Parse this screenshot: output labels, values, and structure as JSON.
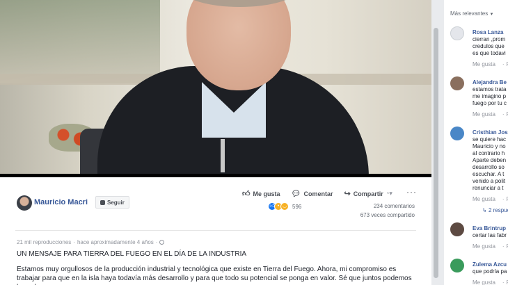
{
  "post": {
    "author": "Mauricio Macri",
    "follow_label": "Seguir",
    "actions": {
      "like": "Me gusta",
      "comment": "Comentar",
      "share": "Compartir"
    },
    "reaction_count": "596",
    "comment_count": "234 comentarios",
    "share_count": "673 veces compartido",
    "views": "21 mil reproducciones",
    "dot": "·",
    "time": "hace aproximadamente 4 años",
    "headline": "UN MENSAJE PARA TIERRA DEL FUEGO EN EL DÍA DE LA INDUSTRIA",
    "body": "Estamos muy orgullosos de la producción industrial y tecnológica que existe en Tierra del Fuego. Ahora, mi compromiso es trabajar para que en la isla haya todavía más desarrollo y para que todo su potencial se ponga en valor. Sé que juntos podemos lograrlo."
  },
  "comments_panel": {
    "sort_label": "Más relevantes",
    "like_label": "Me gusta",
    "reply_label": "Res",
    "items": [
      {
        "name": "Rosa Lanza",
        "lines": [
          "cierran ,prom",
          "credulos que",
          "es que todavi"
        ],
        "avatar_color": "#e4e6eb"
      },
      {
        "name": "Alejandra Be",
        "lines": [
          "estamos trata",
          "me imagino p",
          "fuego por tu c"
        ],
        "avatar_color": "#8a6f5e"
      },
      {
        "name": "Cristhian Jos",
        "lines": [
          "se quiere hac",
          "Mauricio y no",
          "al contrario h",
          "Aparte deben",
          "desarrollo so",
          "escuchar. A t",
          "venido a polit",
          "renunciar a t"
        ],
        "avatar_color": "#4a87c7",
        "replies": "2 respue"
      },
      {
        "name": "Eva Brintrup",
        "lines": [
          "certar las fabr"
        ],
        "avatar_color": "#5d4a42"
      },
      {
        "name": "Zulema Azcu",
        "lines": [
          "que podría pa"
        ],
        "avatar_color": "#3a9b5c"
      }
    ]
  }
}
